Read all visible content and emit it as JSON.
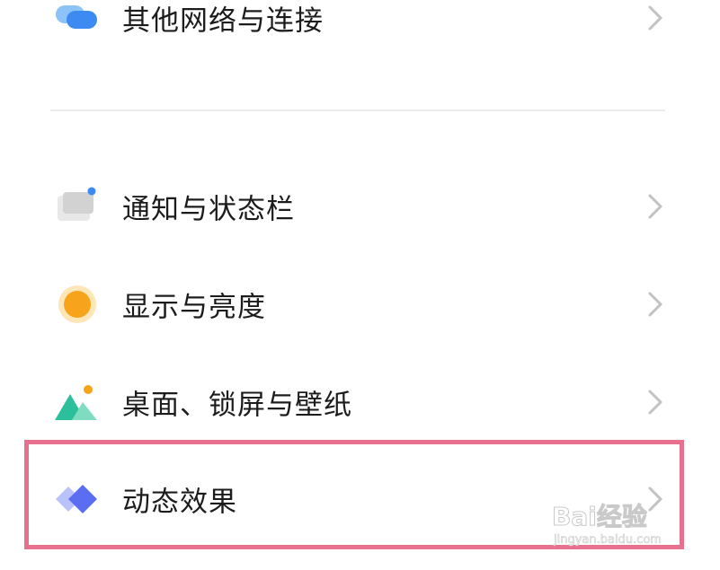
{
  "settings": {
    "items": [
      {
        "label": "其他网络与连接",
        "icon": "network-connection-icon"
      },
      {
        "label": "通知与状态栏",
        "icon": "notification-statusbar-icon"
      },
      {
        "label": "显示与亮度",
        "icon": "display-brightness-icon"
      },
      {
        "label": "桌面、锁屏与壁纸",
        "icon": "desktop-wallpaper-icon"
      },
      {
        "label": "动态效果",
        "icon": "motion-effects-icon"
      }
    ]
  },
  "highlight": {
    "target": "动态效果",
    "color": "#e8708f"
  },
  "watermark": {
    "logo": "Bai经验",
    "url": "jingyan.baidu.com"
  },
  "colors": {
    "network_blue": "#3d8bf2",
    "network_light": "#8cc4f8",
    "display_orange": "#f7a31c",
    "wallpaper_green": "#2bc09b",
    "motion_blue": "#5b6df0",
    "chevron_gray": "#c2c2c2"
  }
}
